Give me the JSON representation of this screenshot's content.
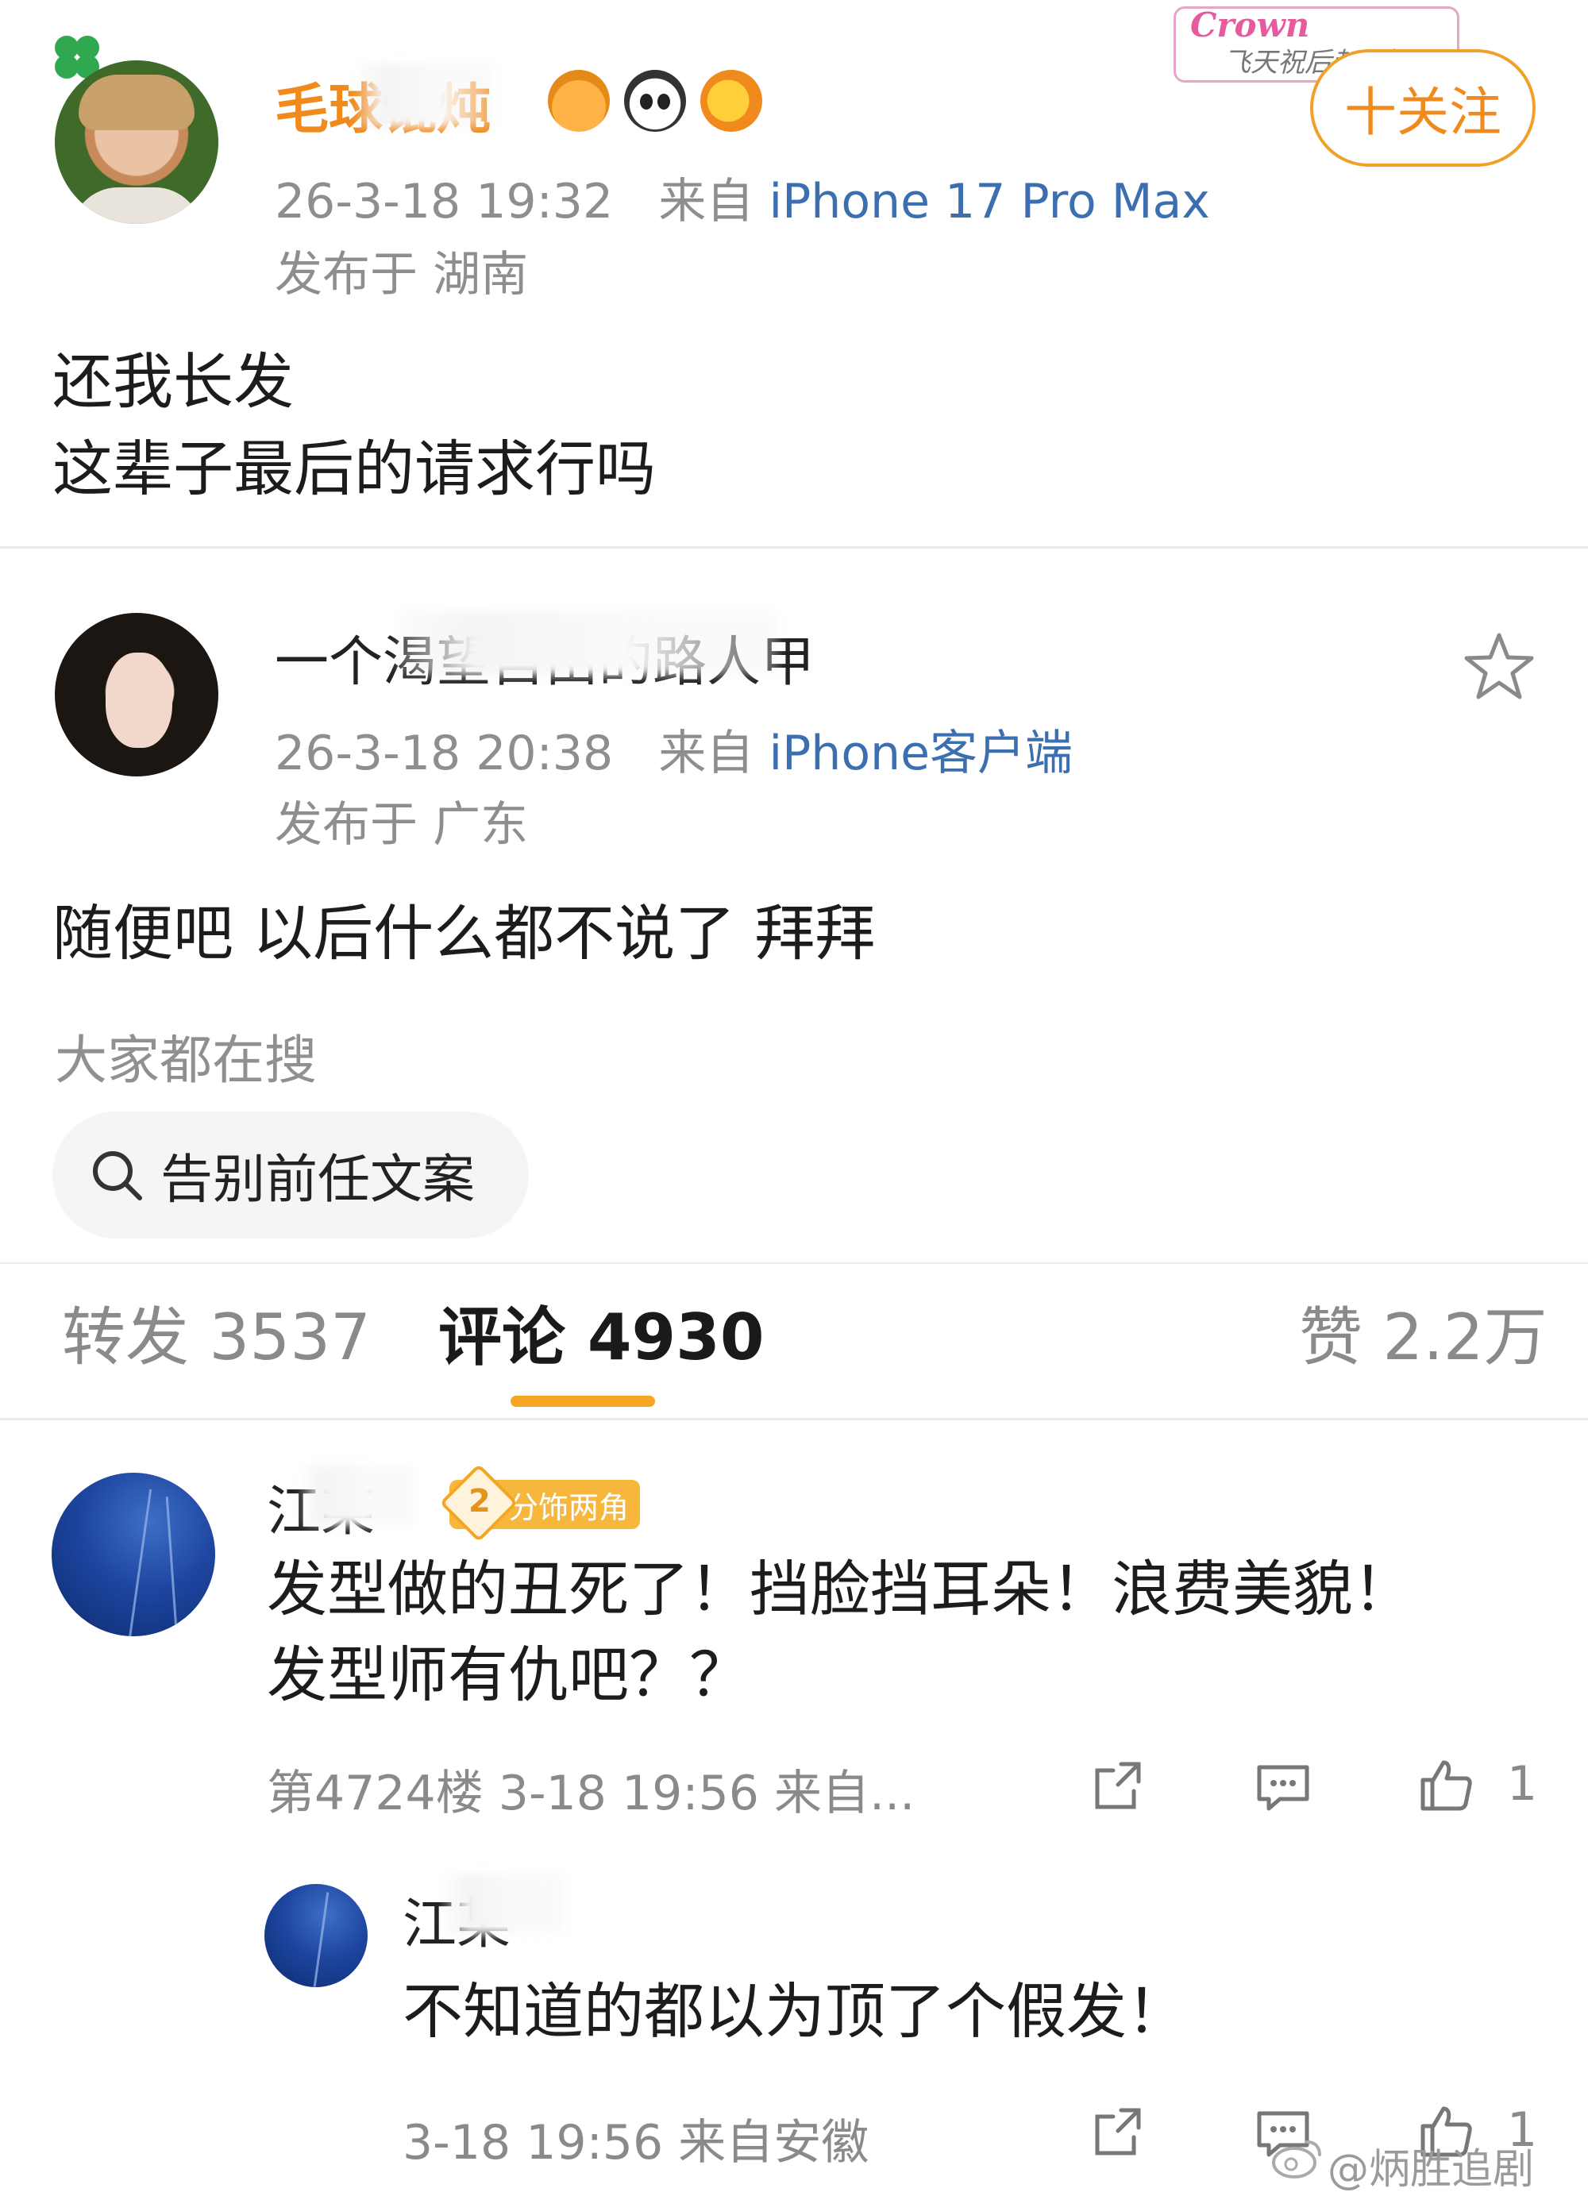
{
  "post": {
    "author": "毛球馄炖",
    "time": "26-3-18 19:32",
    "from_label": "来自",
    "device": "iPhone 17 Pro Max",
    "location": "发布于 湖南",
    "text_line1": "还我长发",
    "text_line2": "这辈子最后的请求行吗",
    "follow_label": "十关注",
    "badge_title": "Crown",
    "badge_sub": "飞天祝后赵丽颖",
    "emojis": [
      "crown-icon",
      "panda-icon",
      "fish-icon"
    ]
  },
  "repost": {
    "author": "一个渴望自由的路人甲",
    "time": "26-3-18 20:38",
    "from_label": "来自",
    "device": "iPhone客户端",
    "location": "发布于 广东",
    "text": "随便吧 以后什么都不说了 拜拜"
  },
  "search": {
    "hint": "大家都在搜",
    "query": "告别前任文案"
  },
  "tabs": {
    "repost": "转发 3537",
    "comments": "评论 4930",
    "likes": "赞 2.2万"
  },
  "comments": [
    {
      "author": "江某",
      "badge_level": "2",
      "badge_label": "分饰两角",
      "text_line1": "发型做的丑死了！挡脸挡耳朵！浪费美貌！",
      "text_line2": "发型师有仇吧？？",
      "meta": "第4724楼 3-18 19:56 来自...",
      "likes": "1"
    },
    {
      "author": "江某",
      "text": "不知道的都以为顶了个假发！",
      "meta": "3-18 19:56 来自安徽",
      "likes": "1"
    }
  ],
  "watermark": "@炳胜追剧",
  "colors": {
    "brand_orange": "#f08a1c",
    "tab_indicator": "#f5a623",
    "device_blue": "#3c6fb0",
    "meta_gray": "#8e8e8e"
  }
}
